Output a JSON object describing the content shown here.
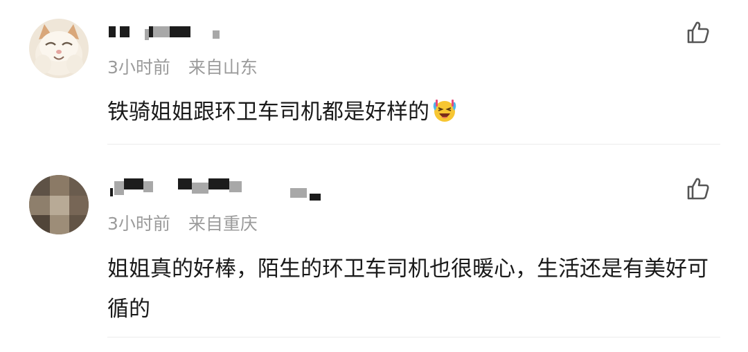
{
  "comments": [
    {
      "time": "3小时前",
      "location": "来自山东",
      "text": "铁骑姐姐跟环卫车司机都是好样的",
      "avatar": "cat-avatar",
      "emoji": "laughing-tears-emoji",
      "like_icon": "thumb-up-icon"
    },
    {
      "time": "3小时前",
      "location": "来自重庆",
      "text": "姐姐真的好棒，陌生的环卫车司机也很暖心，生活还是有美好可循的",
      "avatar": "blurred-avatar",
      "like_icon": "thumb-up-icon"
    }
  ],
  "colors": {
    "text": "#1a1a1a",
    "meta": "#9b9b9b",
    "divider": "#ececec"
  }
}
